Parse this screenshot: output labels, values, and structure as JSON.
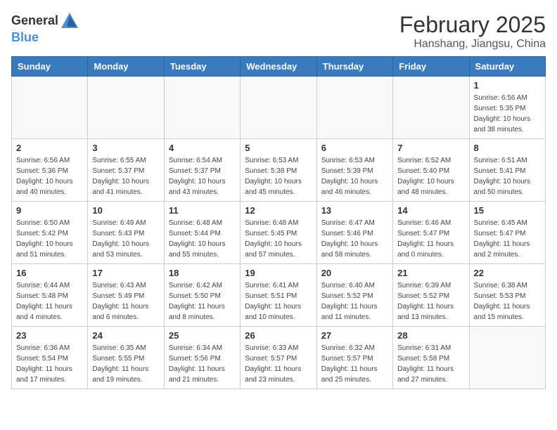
{
  "header": {
    "logo_general": "General",
    "logo_blue": "Blue",
    "title": "February 2025",
    "subtitle": "Hanshang, Jiangsu, China"
  },
  "calendar": {
    "days_of_week": [
      "Sunday",
      "Monday",
      "Tuesday",
      "Wednesday",
      "Thursday",
      "Friday",
      "Saturday"
    ],
    "weeks": [
      [
        {
          "day": "",
          "info": ""
        },
        {
          "day": "",
          "info": ""
        },
        {
          "day": "",
          "info": ""
        },
        {
          "day": "",
          "info": ""
        },
        {
          "day": "",
          "info": ""
        },
        {
          "day": "",
          "info": ""
        },
        {
          "day": "1",
          "info": "Sunrise: 6:56 AM\nSunset: 5:35 PM\nDaylight: 10 hours\nand 38 minutes."
        }
      ],
      [
        {
          "day": "2",
          "info": "Sunrise: 6:56 AM\nSunset: 5:36 PM\nDaylight: 10 hours\nand 40 minutes."
        },
        {
          "day": "3",
          "info": "Sunrise: 6:55 AM\nSunset: 5:37 PM\nDaylight: 10 hours\nand 41 minutes."
        },
        {
          "day": "4",
          "info": "Sunrise: 6:54 AM\nSunset: 5:37 PM\nDaylight: 10 hours\nand 43 minutes."
        },
        {
          "day": "5",
          "info": "Sunrise: 6:53 AM\nSunset: 5:38 PM\nDaylight: 10 hours\nand 45 minutes."
        },
        {
          "day": "6",
          "info": "Sunrise: 6:53 AM\nSunset: 5:39 PM\nDaylight: 10 hours\nand 46 minutes."
        },
        {
          "day": "7",
          "info": "Sunrise: 6:52 AM\nSunset: 5:40 PM\nDaylight: 10 hours\nand 48 minutes."
        },
        {
          "day": "8",
          "info": "Sunrise: 6:51 AM\nSunset: 5:41 PM\nDaylight: 10 hours\nand 50 minutes."
        }
      ],
      [
        {
          "day": "9",
          "info": "Sunrise: 6:50 AM\nSunset: 5:42 PM\nDaylight: 10 hours\nand 51 minutes."
        },
        {
          "day": "10",
          "info": "Sunrise: 6:49 AM\nSunset: 5:43 PM\nDaylight: 10 hours\nand 53 minutes."
        },
        {
          "day": "11",
          "info": "Sunrise: 6:48 AM\nSunset: 5:44 PM\nDaylight: 10 hours\nand 55 minutes."
        },
        {
          "day": "12",
          "info": "Sunrise: 6:48 AM\nSunset: 5:45 PM\nDaylight: 10 hours\nand 57 minutes."
        },
        {
          "day": "13",
          "info": "Sunrise: 6:47 AM\nSunset: 5:46 PM\nDaylight: 10 hours\nand 58 minutes."
        },
        {
          "day": "14",
          "info": "Sunrise: 6:46 AM\nSunset: 5:47 PM\nDaylight: 11 hours\nand 0 minutes."
        },
        {
          "day": "15",
          "info": "Sunrise: 6:45 AM\nSunset: 5:47 PM\nDaylight: 11 hours\nand 2 minutes."
        }
      ],
      [
        {
          "day": "16",
          "info": "Sunrise: 6:44 AM\nSunset: 5:48 PM\nDaylight: 11 hours\nand 4 minutes."
        },
        {
          "day": "17",
          "info": "Sunrise: 6:43 AM\nSunset: 5:49 PM\nDaylight: 11 hours\nand 6 minutes."
        },
        {
          "day": "18",
          "info": "Sunrise: 6:42 AM\nSunset: 5:50 PM\nDaylight: 11 hours\nand 8 minutes."
        },
        {
          "day": "19",
          "info": "Sunrise: 6:41 AM\nSunset: 5:51 PM\nDaylight: 11 hours\nand 10 minutes."
        },
        {
          "day": "20",
          "info": "Sunrise: 6:40 AM\nSunset: 5:52 PM\nDaylight: 11 hours\nand 11 minutes."
        },
        {
          "day": "21",
          "info": "Sunrise: 6:39 AM\nSunset: 5:52 PM\nDaylight: 11 hours\nand 13 minutes."
        },
        {
          "day": "22",
          "info": "Sunrise: 6:38 AM\nSunset: 5:53 PM\nDaylight: 11 hours\nand 15 minutes."
        }
      ],
      [
        {
          "day": "23",
          "info": "Sunrise: 6:36 AM\nSunset: 5:54 PM\nDaylight: 11 hours\nand 17 minutes."
        },
        {
          "day": "24",
          "info": "Sunrise: 6:35 AM\nSunset: 5:55 PM\nDaylight: 11 hours\nand 19 minutes."
        },
        {
          "day": "25",
          "info": "Sunrise: 6:34 AM\nSunset: 5:56 PM\nDaylight: 11 hours\nand 21 minutes."
        },
        {
          "day": "26",
          "info": "Sunrise: 6:33 AM\nSunset: 5:57 PM\nDaylight: 11 hours\nand 23 minutes."
        },
        {
          "day": "27",
          "info": "Sunrise: 6:32 AM\nSunset: 5:57 PM\nDaylight: 11 hours\nand 25 minutes."
        },
        {
          "day": "28",
          "info": "Sunrise: 6:31 AM\nSunset: 5:58 PM\nDaylight: 11 hours\nand 27 minutes."
        },
        {
          "day": "",
          "info": ""
        }
      ]
    ]
  }
}
